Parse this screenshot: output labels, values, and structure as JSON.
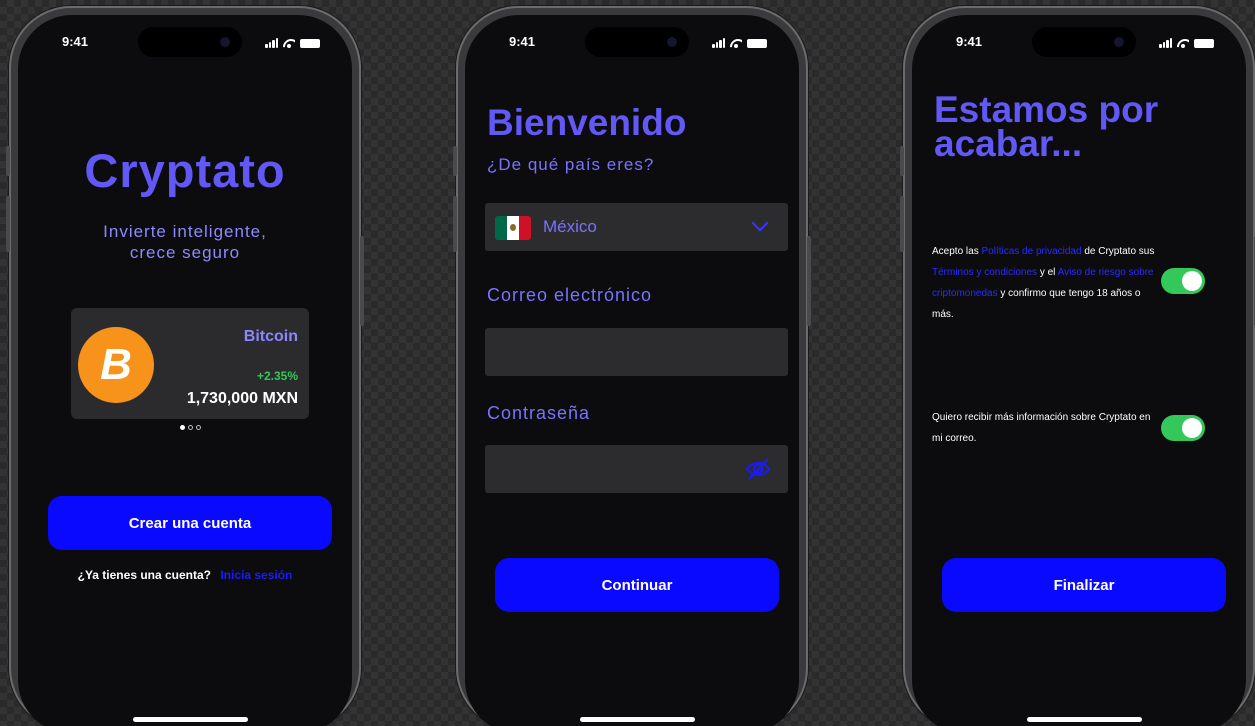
{
  "status_bar": {
    "time": "9:41"
  },
  "screen1": {
    "brand": "Cryptato",
    "tagline_line1": "Invierte inteligente,",
    "tagline_line2": "crece seguro",
    "coin": {
      "symbol": "B",
      "name": "Bitcoin",
      "change": "+2.35%",
      "price": "1,730,000 MXN"
    },
    "create_account": "Crear una cuenta",
    "have_account": "¿Ya tienes una cuenta?",
    "login_link": "Inicia sesión"
  },
  "screen2": {
    "title": "Bienvenido",
    "country_question": "¿De qué país eres?",
    "country_value": "México",
    "email_label": "Correo electrónico",
    "email_value": "",
    "password_label": "Contraseña",
    "password_value": "",
    "continue": "Continuar"
  },
  "screen3": {
    "title_line1": "Estamos por",
    "title_line2": "acabar...",
    "consent": {
      "t1": "Acepto las ",
      "l1": "Políticas de privacidad",
      "t2": " de Cryptato sus ",
      "l2": "Términos y condiciones",
      "t3": " y el ",
      "l3": "Aviso de riesgo sobre criptomonedas",
      "t4": " y confirmo que tengo 18 años o más.",
      "on": true
    },
    "newsletter": {
      "text": "Quiero recibir más información sobre Cryptato en mi correo.",
      "on": true
    },
    "finish": "Finalizar"
  },
  "colors": {
    "accent": "#6158f5",
    "button": "#0a09ff",
    "toggle_on": "#34c759",
    "bitcoin": "#f7931a"
  },
  "icons": [
    "signal-icon",
    "wifi-icon",
    "battery-icon",
    "bitcoin-icon",
    "chevron-down-icon",
    "eye-slash-icon",
    "mexico-flag-icon"
  ]
}
